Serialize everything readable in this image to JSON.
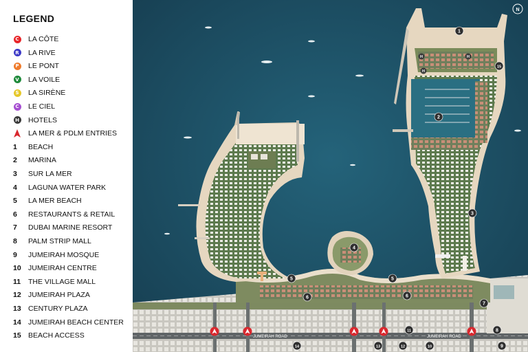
{
  "legend": {
    "title": "LEGEND",
    "items": [
      {
        "marker": "circle",
        "letter": "C",
        "color": "#e8262a",
        "label": "LA CÔTE"
      },
      {
        "marker": "circle",
        "letter": "R",
        "color": "#3e3bc7",
        "label": "LA RIVE"
      },
      {
        "marker": "circle",
        "letter": "P",
        "color": "#ef7b2b",
        "label": "LE PONT"
      },
      {
        "marker": "circle",
        "letter": "V",
        "color": "#1f8a3b",
        "label": "LA VOILE"
      },
      {
        "marker": "circle",
        "letter": "S",
        "color": "#e6c82a",
        "label": "LA SIRÈNE"
      },
      {
        "marker": "circle",
        "letter": "C",
        "color": "#a64fd1",
        "label": "LE CIEL"
      },
      {
        "marker": "circle",
        "letter": "H",
        "color": "#3a3a3a",
        "label": "HOTELS"
      },
      {
        "marker": "triangle",
        "color": "#d9282e",
        "label": "LA MER & PDLM ENTRIES"
      },
      {
        "marker": "number",
        "number": "1",
        "label": "BEACH"
      },
      {
        "marker": "number",
        "number": "2",
        "label": "MARINA"
      },
      {
        "marker": "number",
        "number": "3",
        "label": "SUR LA MER"
      },
      {
        "marker": "number",
        "number": "4",
        "label": "LAGUNA WATER PARK"
      },
      {
        "marker": "number",
        "number": "5",
        "label": "LA MER BEACH"
      },
      {
        "marker": "number",
        "number": "6",
        "label": "RESTAURANTS & RETAIL"
      },
      {
        "marker": "number",
        "number": "7",
        "label": "DUBAI MARINE RESORT"
      },
      {
        "marker": "number",
        "number": "8",
        "label": "PALM STRIP MALL"
      },
      {
        "marker": "number",
        "number": "9",
        "label": "JUMEIRAH MOSQUE"
      },
      {
        "marker": "number",
        "number": "10",
        "label": "JUMEIRAH CENTRE"
      },
      {
        "marker": "number",
        "number": "11",
        "label": "THE VILLAGE MALL"
      },
      {
        "marker": "number",
        "number": "12",
        "label": "JUMEIRAH PLAZA"
      },
      {
        "marker": "number",
        "number": "13",
        "label": "CENTURY PLAZA"
      },
      {
        "marker": "number",
        "number": "14",
        "label": "JUMEIRAH BEACH CENTER"
      },
      {
        "marker": "number",
        "number": "15",
        "label": "BEACH ACCESS"
      }
    ]
  },
  "map": {
    "road_label_left": "JUMEIRAH ROAD",
    "road_label_right": "JUMEIRAH ROAD",
    "compass_letter": "N",
    "colors": {
      "sea": "#1c4e62",
      "sand": "#e9dccb",
      "land": "#8a8f78",
      "pin": "#2f2f2f",
      "entry": "#d9282e"
    },
    "pins": [
      {
        "id": "1",
        "label": "1"
      },
      {
        "id": "2",
        "label": "2"
      },
      {
        "id": "3",
        "label": "3"
      },
      {
        "id": "4",
        "label": "4"
      },
      {
        "id": "5a",
        "label": "5"
      },
      {
        "id": "5b",
        "label": "5"
      },
      {
        "id": "6a",
        "label": "6"
      },
      {
        "id": "6b",
        "label": "6"
      },
      {
        "id": "7",
        "label": "7"
      },
      {
        "id": "8",
        "label": "8"
      },
      {
        "id": "9",
        "label": "9"
      },
      {
        "id": "10",
        "label": "10"
      },
      {
        "id": "11",
        "label": "11"
      },
      {
        "id": "12",
        "label": "12"
      },
      {
        "id": "13",
        "label": "13"
      },
      {
        "id": "14",
        "label": "14"
      },
      {
        "id": "15",
        "label": "15"
      }
    ],
    "hotel_pins": [
      {
        "label": "H"
      },
      {
        "label": "H"
      },
      {
        "label": "H"
      }
    ]
  }
}
